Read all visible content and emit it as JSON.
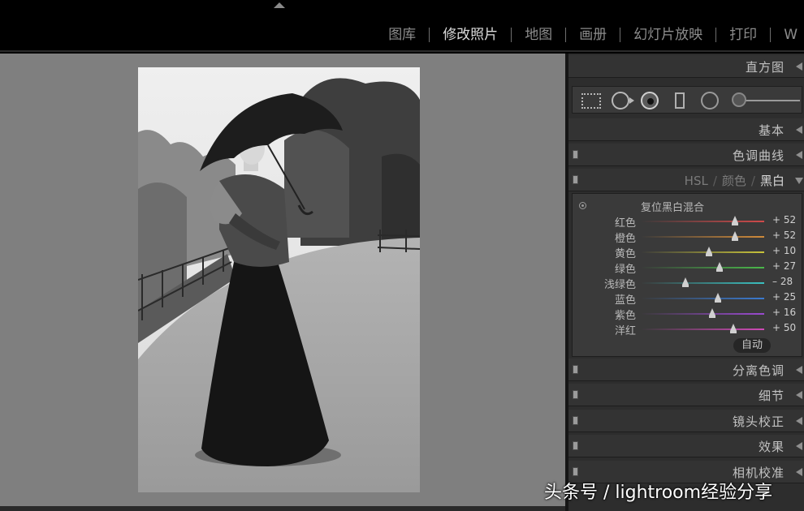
{
  "modules": [
    "图库",
    "修改照片",
    "地图",
    "画册",
    "幻灯片放映",
    "打印",
    "W"
  ],
  "active_module_index": 1,
  "panel": {
    "histogram": "直方图",
    "basic": "基本",
    "tone_curve": "色调曲线",
    "hsl_tabs": [
      "HSL",
      "颜色",
      "黑白"
    ],
    "hsl_active": "黑白",
    "bw": {
      "reset_label": "复位黑白混合",
      "sliders": [
        {
          "label": "红色",
          "value": 52,
          "display": "+ 52",
          "gradient": [
            "#3a3a3a",
            "#d04a4a"
          ]
        },
        {
          "label": "橙色",
          "value": 52,
          "display": "+ 52",
          "gradient": [
            "#3a3a3a",
            "#d08a3a"
          ]
        },
        {
          "label": "黄色",
          "value": 10,
          "display": "+ 10",
          "gradient": [
            "#3a3a3a",
            "#c8c33a"
          ]
        },
        {
          "label": "绿色",
          "value": 27,
          "display": "+ 27",
          "gradient": [
            "#3a3a3a",
            "#4ab84a"
          ]
        },
        {
          "label": "浅绿色",
          "value": -28,
          "display": "– 28",
          "gradient": [
            "#3a3a3a",
            "#3ac0c0"
          ]
        },
        {
          "label": "蓝色",
          "value": 25,
          "display": "+ 25",
          "gradient": [
            "#3a3a3a",
            "#3a7ad0"
          ]
        },
        {
          "label": "紫色",
          "value": 16,
          "display": "+ 16",
          "gradient": [
            "#3a3a3a",
            "#9a4ad0"
          ]
        },
        {
          "label": "洋红",
          "value": 50,
          "display": "+ 50",
          "gradient": [
            "#3a3a3a",
            "#d04ab8"
          ]
        }
      ],
      "auto_label": "自动"
    },
    "split_toning": "分离色调",
    "detail": "细节",
    "lens_corrections": "镜头校正",
    "effects": "效果",
    "camera_calibration": "相机校准"
  },
  "watermark": "头条号 / lightroom经验分享"
}
